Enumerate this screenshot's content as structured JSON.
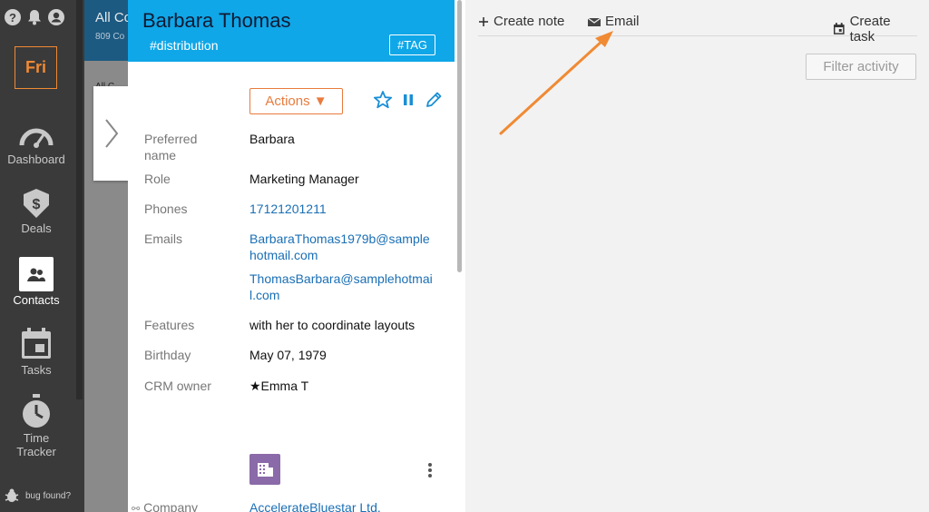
{
  "sidebar": {
    "org_badge": "Fri",
    "items": [
      {
        "label": "Dashboard",
        "icon": "gauge-icon"
      },
      {
        "label": "Deals",
        "icon": "dollar-tag-icon"
      },
      {
        "label": "Contacts",
        "icon": "contacts-icon"
      },
      {
        "label": "Tasks",
        "icon": "calendar-icon"
      },
      {
        "label": "Time\nTracker",
        "icon": "stopwatch-icon"
      }
    ],
    "bug_label": "bug found?"
  },
  "list": {
    "title": "All Co",
    "subtitle": "809 Co",
    "sub_row": "All C"
  },
  "contact": {
    "name": "Barbara Thomas",
    "hashtag": "#distribution",
    "tag_button": "#TAG",
    "actions_label": "Actions ▼",
    "fields": [
      {
        "label": "Preferred\nname",
        "value": "Barbara"
      },
      {
        "label": "Role",
        "value": "Marketing Manager"
      },
      {
        "label": "Phones",
        "value": "17121201211"
      },
      {
        "label": "Emails",
        "value": "BarbaraThomas1979b@sample\nhotmail.com"
      },
      {
        "label": "",
        "value": "ThomasBarbara@samplehotmai\nl.com"
      },
      {
        "label": "Features",
        "value": "with her to coordinate layouts"
      },
      {
        "label": "Birthday",
        "value": "May 07, 1979"
      },
      {
        "label": "CRM owner",
        "value": "★Emma T"
      },
      {
        "label": "Company",
        "value": "AccelerateBluestar Ltd."
      }
    ]
  },
  "activity": {
    "create_note": "Create note",
    "email": "Email",
    "create_task": "Create task",
    "filter_placeholder": "Filter activity"
  },
  "colors": {
    "accent_blue": "#0fa7e8",
    "accent_orange": "#e87b3d",
    "link_blue": "#1a6fb5",
    "sidebar_bg": "#3a3a3a"
  }
}
